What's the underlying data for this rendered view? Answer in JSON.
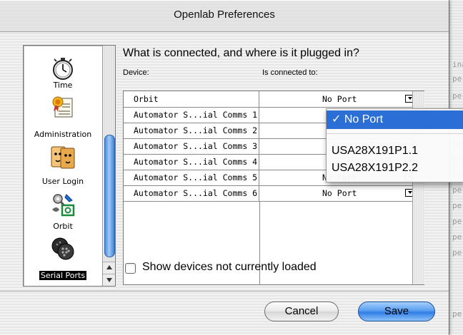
{
  "window": {
    "title": "Openlab Preferences"
  },
  "sidebar": {
    "items": [
      {
        "label": "Time",
        "icon": "stopwatch-icon"
      },
      {
        "label": "Administration",
        "icon": "certificate-icon"
      },
      {
        "label": "User Login",
        "icon": "user-faces-icon"
      },
      {
        "label": "Orbit",
        "icon": "tools-icon"
      },
      {
        "label": "Serial Ports",
        "icon": "serial-port-icon",
        "selected": true
      }
    ]
  },
  "main": {
    "heading": "What is connected, and where is it plugged in?",
    "col_device": "Device:",
    "col_connected": "Is connected to:",
    "rows": [
      {
        "device": "Orbit",
        "port": "No Port"
      },
      {
        "device": "Automator S...ial Comms 1",
        "port": ""
      },
      {
        "device": "Automator S...ial Comms 2",
        "port": ""
      },
      {
        "device": "Automator S...ial Comms 3",
        "port": ""
      },
      {
        "device": "Automator S...ial Comms 4",
        "port": ""
      },
      {
        "device": "Automator S...ial Comms 5",
        "port": "No Port"
      },
      {
        "device": "Automator S...ial Comms 6",
        "port": "No Port"
      }
    ],
    "show_unloaded_label": "Show devices not currently loaded"
  },
  "popup_menu": {
    "items": [
      {
        "label": "✓ No Port",
        "selected": true
      },
      {
        "label": "USA28X191P1.1"
      },
      {
        "label": "USA28X191P2.2"
      }
    ]
  },
  "buttons": {
    "cancel": "Cancel",
    "save": "Save"
  },
  "background_window": {
    "lines": [
      "ina",
      "pe",
      "pe",
      "pe",
      "pe",
      "pe",
      "pe",
      "pe",
      "pe",
      "pe",
      "pe",
      "pe",
      "pe",
      "pe"
    ]
  },
  "colors": {
    "accent": "#2b6fd6",
    "save_button": "#5a9ef0",
    "scroll_thumb": "#4a8fe0"
  }
}
